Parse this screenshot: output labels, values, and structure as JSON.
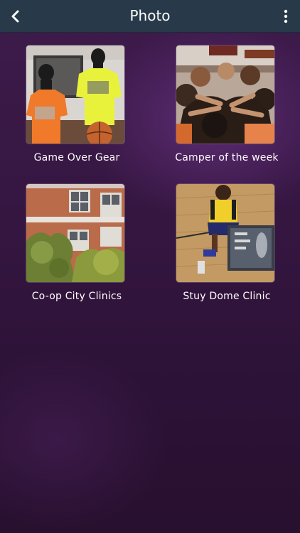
{
  "header": {
    "title": "Photo",
    "back_icon": "chevron-left-icon",
    "menu_icon": "more-vertical-icon"
  },
  "gallery": {
    "items": [
      {
        "label": "Game Over Gear"
      },
      {
        "label": "Camper of the week"
      },
      {
        "label": "Co-op City Clinics"
      },
      {
        "label": "Stuy Dome Clinic"
      }
    ]
  },
  "colors": {
    "header_bg": "#283a4a",
    "background": "#351641",
    "text": "#ffffff"
  }
}
